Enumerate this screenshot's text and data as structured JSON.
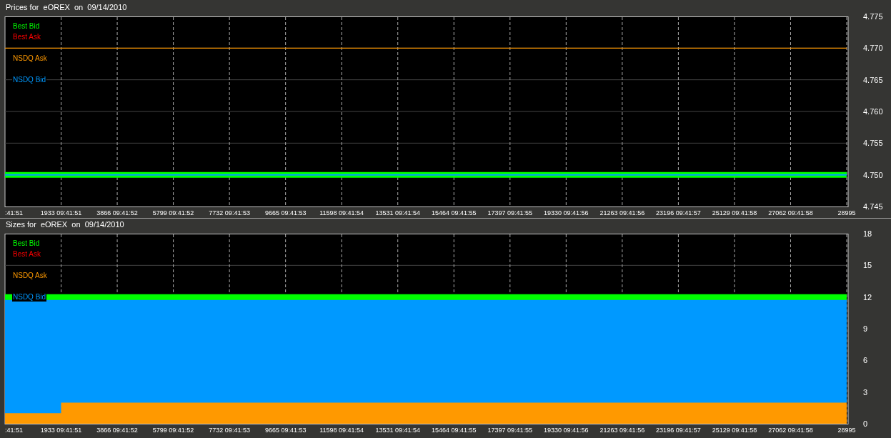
{
  "panels": [
    {
      "title": "Prices for  eOREX  on  09/14/2010",
      "chart_data": {
        "type": "line",
        "grid": true,
        "categories": [
          ":41:51",
          "1933 09:41:51",
          "3866 09:41:52",
          "5799 09:41:52",
          "7732 09:41:53",
          "9665 09:41:53",
          "11598 09:41:54",
          "13531 09:41:54",
          "15464 09:41:55",
          "17397 09:41:55",
          "19330 09:41:56",
          "21263 09:41:56",
          "23196 09:41:57",
          "25129 09:41:58",
          "27062 09:41:58",
          "28995"
        ],
        "ylim": [
          4.745,
          4.775
        ],
        "yticks": [
          {
            "value": 4.745,
            "label": "4.745"
          },
          {
            "value": 4.75,
            "label": "4.750"
          },
          {
            "value": 4.755,
            "label": "4.755"
          },
          {
            "value": 4.76,
            "label": "4.760"
          },
          {
            "value": 4.765,
            "label": "4.765"
          },
          {
            "value": 4.77,
            "label": "4.770"
          },
          {
            "value": 4.775,
            "label": "4.775"
          }
        ],
        "series": [
          {
            "name": "Best Bid",
            "color": "#00ff00",
            "values": [
              4.75,
              4.75,
              4.75,
              4.75,
              4.75,
              4.75,
              4.75,
              4.75,
              4.75,
              4.75,
              4.75,
              4.75,
              4.75,
              4.75,
              4.75,
              4.75
            ]
          },
          {
            "name": "Best Ask",
            "color": "#ff0000",
            "values": [
              null,
              null,
              null,
              null,
              null,
              null,
              null,
              null,
              null,
              null,
              null,
              null,
              null,
              null,
              null,
              null
            ]
          },
          {
            "name": "NSDQ Ask",
            "color": "#ff9900",
            "values": [
              4.77,
              4.77,
              4.77,
              4.77,
              4.77,
              4.77,
              4.77,
              4.77,
              4.77,
              4.77,
              4.77,
              4.77,
              4.77,
              4.77,
              4.77,
              4.77
            ]
          },
          {
            "name": "NSDQ Bid",
            "color": "#0099ff",
            "values": [
              4.75,
              4.75,
              4.75,
              4.75,
              4.75,
              4.75,
              4.75,
              4.75,
              4.75,
              4.75,
              4.75,
              4.75,
              4.75,
              4.75,
              4.75,
              4.75
            ]
          }
        ]
      }
    },
    {
      "title": "Sizes for  eOREX  on  09/14/2010",
      "chart_data": {
        "type": "area",
        "grid": true,
        "categories": [
          ":41:51",
          "1933 09:41:51",
          "3866 09:41:52",
          "5799 09:41:52",
          "7732 09:41:53",
          "9665 09:41:53",
          "11598 09:41:54",
          "13531 09:41:54",
          "15464 09:41:55",
          "17397 09:41:55",
          "19330 09:41:56",
          "21263 09:41:56",
          "23196 09:41:57",
          "25129 09:41:58",
          "27062 09:41:58",
          "28995"
        ],
        "ylim": [
          0,
          18
        ],
        "yticks": [
          {
            "value": 0,
            "label": "0"
          },
          {
            "value": 3,
            "label": "3"
          },
          {
            "value": 6,
            "label": "6"
          },
          {
            "value": 9,
            "label": "9"
          },
          {
            "value": 12,
            "label": "12"
          },
          {
            "value": 15,
            "label": "15"
          },
          {
            "value": 18,
            "label": "18"
          }
        ],
        "series": [
          {
            "name": "Best Bid",
            "type": "line",
            "color": "#00ff00",
            "values": [
              12,
              12,
              12,
              12,
              12,
              12,
              12,
              12,
              12,
              12,
              12,
              12,
              12,
              12,
              12,
              12
            ]
          },
          {
            "name": "Best Ask",
            "type": "line",
            "color": "#ff0000",
            "values": [
              null,
              null,
              null,
              null,
              null,
              null,
              null,
              null,
              null,
              null,
              null,
              null,
              null,
              null,
              null,
              null
            ]
          },
          {
            "name": "NSDQ Ask",
            "type": "area",
            "color": "#ff9900",
            "values": [
              1,
              2,
              2,
              2,
              2,
              2,
              2,
              2,
              2,
              2,
              2,
              2,
              2,
              2,
              2,
              2
            ]
          },
          {
            "name": "NSDQ Bid",
            "type": "area",
            "color": "#0099ff",
            "values": [
              12,
              12,
              12,
              12,
              12,
              12,
              12,
              12,
              12,
              12,
              12,
              12,
              12,
              12,
              12,
              12
            ]
          }
        ]
      }
    }
  ]
}
